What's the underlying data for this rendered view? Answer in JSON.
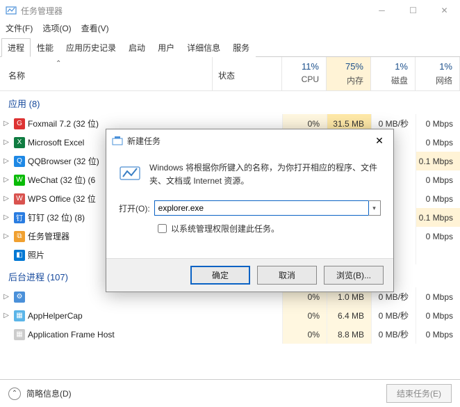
{
  "window": {
    "title": "任务管理器",
    "menu": {
      "file": "文件(F)",
      "options": "选项(O)",
      "view": "查看(V)"
    }
  },
  "tabs": {
    "processes": "进程",
    "performance": "性能",
    "history": "应用历史记录",
    "startup": "启动",
    "users": "用户",
    "details": "详细信息",
    "services": "服务"
  },
  "columns": {
    "name": "名称",
    "status": "状态",
    "cpu_pct": "11%",
    "cpu_lbl": "CPU",
    "mem_pct": "75%",
    "mem_lbl": "内存",
    "disk_pct": "1%",
    "disk_lbl": "磁盘",
    "net_pct": "1%",
    "net_lbl": "网络"
  },
  "groups": {
    "apps": {
      "title": "应用 (8)"
    },
    "bg": {
      "title": "后台进程 (107)"
    }
  },
  "rows": {
    "foxmail": {
      "label": "Foxmail 7.2 (32 位) ",
      "cpu": "0%",
      "mem": "31.5 MB",
      "disk": "0 MB/秒",
      "net": "0 Mbps"
    },
    "excel": {
      "label": "Microsoft Excel",
      "net": "0 Mbps"
    },
    "qqb": {
      "label": "QQBrowser (32 位) ",
      "net": "0.1 Mbps"
    },
    "wechat": {
      "label": "WeChat (32 位) (6",
      "net": "0 Mbps"
    },
    "wps": {
      "label": "WPS Office (32 位",
      "net": "0 Mbps"
    },
    "dingding": {
      "label": "钉钉 (32 位) (8)",
      "net": "0.1 Mbps"
    },
    "taskmgr": {
      "label": "任务管理器",
      "net": "0 Mbps"
    },
    "photos": {
      "label": "照片",
      "net": ""
    },
    "bg1": {
      "label": "",
      "cpu": "0%",
      "mem": "1.0 MB",
      "disk": "0 MB/秒",
      "net": "0 Mbps"
    },
    "bg2": {
      "label": "AppHelperCap",
      "cpu": "0%",
      "mem": "6.4 MB",
      "disk": "0 MB/秒",
      "net": "0 Mbps"
    },
    "bg3": {
      "label": "Application Frame Host",
      "cpu": "0%",
      "mem": "8.8 MB",
      "disk": "0 MB/秒",
      "net": "0 Mbps"
    }
  },
  "dialog": {
    "title": "新建任务",
    "message": "Windows 将根据你所键入的名称，为你打开相应的程序、文件夹、文档或 Internet 资源。",
    "open_label": "打开(O):",
    "input_value": "explorer.exe",
    "checkbox_label": "以系统管理权限创建此任务。",
    "ok": "确定",
    "cancel": "取消",
    "browse": "浏览(B)..."
  },
  "footer": {
    "simple": "简略信息(D)",
    "endtask": "结束任务(E)"
  }
}
